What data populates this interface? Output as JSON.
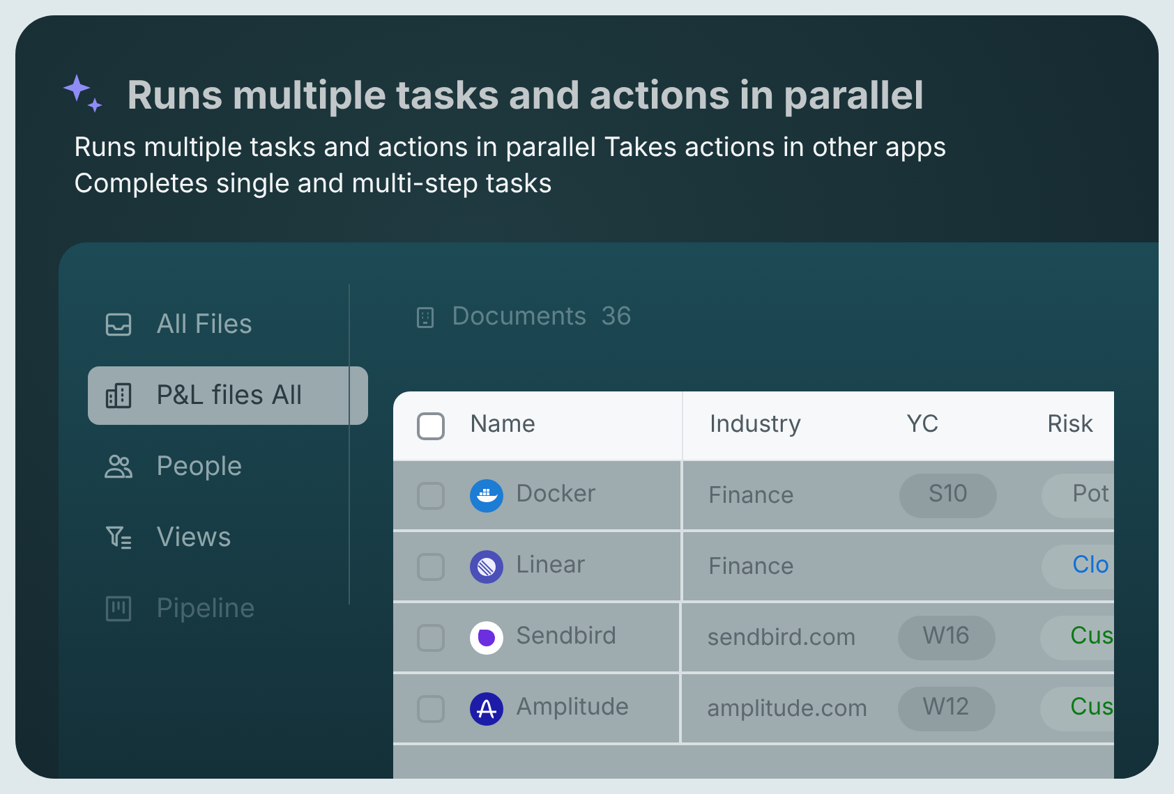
{
  "title": "Runs multiple tasks and actions in parallel",
  "description": "Runs multiple tasks and actions in parallel Takes actions in other apps Completes single and multi-step tasks",
  "sidebar": {
    "items": [
      {
        "label": "All Files",
        "selected": false
      },
      {
        "label": "P&L files All",
        "selected": true
      },
      {
        "label": "People",
        "selected": false
      },
      {
        "label": "Views",
        "selected": false
      },
      {
        "label": "Pipeline",
        "selected": false
      }
    ]
  },
  "documents": {
    "label": "Documents",
    "count": "36"
  },
  "table": {
    "header_checked": false,
    "columns": [
      "Name",
      "Industry",
      "YC",
      "Risk"
    ],
    "rows": [
      {
        "checked": false,
        "name": "Docker",
        "industry": "Finance",
        "yc": "S10",
        "risk": {
          "text": "Pot",
          "color": "#5f6b70"
        }
      },
      {
        "checked": false,
        "name": "Linear",
        "industry": "Finance",
        "risk": {
          "text": "Clo",
          "color": "#0f6fd6"
        }
      },
      {
        "checked": false,
        "name": "Sendbird",
        "industry": "sendbird.com",
        "yc": "W16",
        "risk": {
          "text": "Cus",
          "color": "#0a7a14"
        }
      },
      {
        "checked": false,
        "name": "Amplitude",
        "industry": "amplitude.com",
        "yc": "W12",
        "risk": {
          "text": "Cus",
          "color": "#0a7a14"
        }
      }
    ]
  }
}
